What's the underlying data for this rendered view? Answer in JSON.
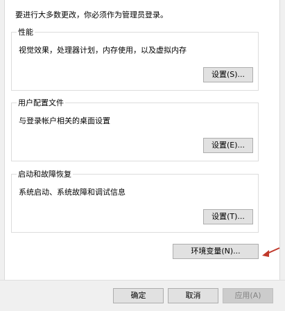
{
  "dialog": {
    "notice": "要进行大多数更改，你必须作为管理员登录。",
    "performance": {
      "title": "性能",
      "description": "视觉效果，处理器计划，内存使用，以及虚拟内存",
      "settings_button": "设置(S)..."
    },
    "user_profiles": {
      "title": "用户配置文件",
      "description": "与登录帐户相关的桌面设置",
      "settings_button": "设置(E)..."
    },
    "startup_recovery": {
      "title": "启动和故障恢复",
      "description": "系统启动、系统故障和调试信息",
      "settings_button": "设置(T)..."
    },
    "env_vars_button": "环境变量(N)...",
    "footer": {
      "ok": "确定",
      "cancel": "取消",
      "apply": "应用(A)"
    },
    "annotation_arrow_color": "#c0392b"
  }
}
